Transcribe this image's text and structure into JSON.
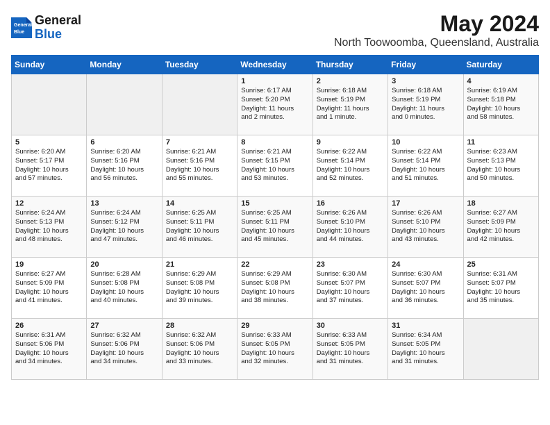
{
  "logo": {
    "general": "General",
    "blue": "Blue"
  },
  "header": {
    "title": "May 2024",
    "subtitle": "North Toowoomba, Queensland, Australia"
  },
  "days_of_week": [
    "Sunday",
    "Monday",
    "Tuesday",
    "Wednesday",
    "Thursday",
    "Friday",
    "Saturday"
  ],
  "weeks": [
    [
      {
        "day": "",
        "info": ""
      },
      {
        "day": "",
        "info": ""
      },
      {
        "day": "",
        "info": ""
      },
      {
        "day": "1",
        "info": "Sunrise: 6:17 AM\nSunset: 5:20 PM\nDaylight: 11 hours\nand 2 minutes."
      },
      {
        "day": "2",
        "info": "Sunrise: 6:18 AM\nSunset: 5:19 PM\nDaylight: 11 hours\nand 1 minute."
      },
      {
        "day": "3",
        "info": "Sunrise: 6:18 AM\nSunset: 5:19 PM\nDaylight: 11 hours\nand 0 minutes."
      },
      {
        "day": "4",
        "info": "Sunrise: 6:19 AM\nSunset: 5:18 PM\nDaylight: 10 hours\nand 58 minutes."
      }
    ],
    [
      {
        "day": "5",
        "info": "Sunrise: 6:20 AM\nSunset: 5:17 PM\nDaylight: 10 hours\nand 57 minutes."
      },
      {
        "day": "6",
        "info": "Sunrise: 6:20 AM\nSunset: 5:16 PM\nDaylight: 10 hours\nand 56 minutes."
      },
      {
        "day": "7",
        "info": "Sunrise: 6:21 AM\nSunset: 5:16 PM\nDaylight: 10 hours\nand 55 minutes."
      },
      {
        "day": "8",
        "info": "Sunrise: 6:21 AM\nSunset: 5:15 PM\nDaylight: 10 hours\nand 53 minutes."
      },
      {
        "day": "9",
        "info": "Sunrise: 6:22 AM\nSunset: 5:14 PM\nDaylight: 10 hours\nand 52 minutes."
      },
      {
        "day": "10",
        "info": "Sunrise: 6:22 AM\nSunset: 5:14 PM\nDaylight: 10 hours\nand 51 minutes."
      },
      {
        "day": "11",
        "info": "Sunrise: 6:23 AM\nSunset: 5:13 PM\nDaylight: 10 hours\nand 50 minutes."
      }
    ],
    [
      {
        "day": "12",
        "info": "Sunrise: 6:24 AM\nSunset: 5:13 PM\nDaylight: 10 hours\nand 48 minutes."
      },
      {
        "day": "13",
        "info": "Sunrise: 6:24 AM\nSunset: 5:12 PM\nDaylight: 10 hours\nand 47 minutes."
      },
      {
        "day": "14",
        "info": "Sunrise: 6:25 AM\nSunset: 5:11 PM\nDaylight: 10 hours\nand 46 minutes."
      },
      {
        "day": "15",
        "info": "Sunrise: 6:25 AM\nSunset: 5:11 PM\nDaylight: 10 hours\nand 45 minutes."
      },
      {
        "day": "16",
        "info": "Sunrise: 6:26 AM\nSunset: 5:10 PM\nDaylight: 10 hours\nand 44 minutes."
      },
      {
        "day": "17",
        "info": "Sunrise: 6:26 AM\nSunset: 5:10 PM\nDaylight: 10 hours\nand 43 minutes."
      },
      {
        "day": "18",
        "info": "Sunrise: 6:27 AM\nSunset: 5:09 PM\nDaylight: 10 hours\nand 42 minutes."
      }
    ],
    [
      {
        "day": "19",
        "info": "Sunrise: 6:27 AM\nSunset: 5:09 PM\nDaylight: 10 hours\nand 41 minutes."
      },
      {
        "day": "20",
        "info": "Sunrise: 6:28 AM\nSunset: 5:08 PM\nDaylight: 10 hours\nand 40 minutes."
      },
      {
        "day": "21",
        "info": "Sunrise: 6:29 AM\nSunset: 5:08 PM\nDaylight: 10 hours\nand 39 minutes."
      },
      {
        "day": "22",
        "info": "Sunrise: 6:29 AM\nSunset: 5:08 PM\nDaylight: 10 hours\nand 38 minutes."
      },
      {
        "day": "23",
        "info": "Sunrise: 6:30 AM\nSunset: 5:07 PM\nDaylight: 10 hours\nand 37 minutes."
      },
      {
        "day": "24",
        "info": "Sunrise: 6:30 AM\nSunset: 5:07 PM\nDaylight: 10 hours\nand 36 minutes."
      },
      {
        "day": "25",
        "info": "Sunrise: 6:31 AM\nSunset: 5:07 PM\nDaylight: 10 hours\nand 35 minutes."
      }
    ],
    [
      {
        "day": "26",
        "info": "Sunrise: 6:31 AM\nSunset: 5:06 PM\nDaylight: 10 hours\nand 34 minutes."
      },
      {
        "day": "27",
        "info": "Sunrise: 6:32 AM\nSunset: 5:06 PM\nDaylight: 10 hours\nand 34 minutes."
      },
      {
        "day": "28",
        "info": "Sunrise: 6:32 AM\nSunset: 5:06 PM\nDaylight: 10 hours\nand 33 minutes."
      },
      {
        "day": "29",
        "info": "Sunrise: 6:33 AM\nSunset: 5:05 PM\nDaylight: 10 hours\nand 32 minutes."
      },
      {
        "day": "30",
        "info": "Sunrise: 6:33 AM\nSunset: 5:05 PM\nDaylight: 10 hours\nand 31 minutes."
      },
      {
        "day": "31",
        "info": "Sunrise: 6:34 AM\nSunset: 5:05 PM\nDaylight: 10 hours\nand 31 minutes."
      },
      {
        "day": "",
        "info": ""
      }
    ]
  ]
}
